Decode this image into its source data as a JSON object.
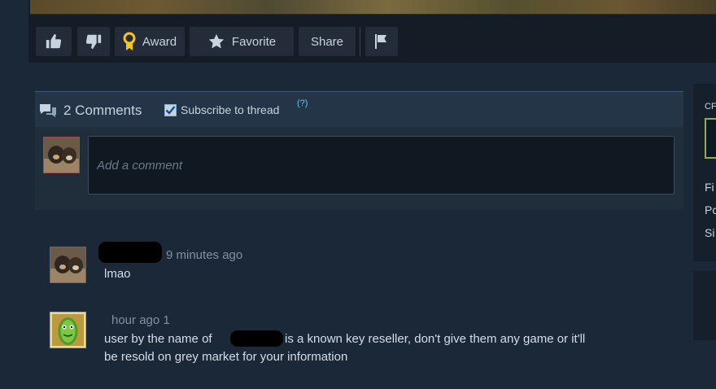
{
  "toolbar": {
    "award_label": "Award",
    "favorite_label": "Favorite",
    "share_label": "Share"
  },
  "comments": {
    "count_label": "2 Comments",
    "subscribe_label": "Subscribe to thread",
    "help_label": "(?)",
    "input_placeholder": "Add a comment",
    "items": [
      {
        "timestamp": "9 minutes ago",
        "text": "lmao"
      },
      {
        "timestamp": "hour ago 1",
        "text_before": "user by the name of",
        "text_after": "is a known key reseller, don't give them any game or it'll",
        "text_line2": "be resold on grey market for your information"
      }
    ]
  },
  "sidebar": {
    "label_top": "CF",
    "label_a": "Fi",
    "label_b": "Pc",
    "label_c": "Si"
  },
  "colors": {
    "background": "#1b2838",
    "panel": "#202d3b",
    "link": "#66c0f4",
    "award_gold": "#f5c518"
  }
}
